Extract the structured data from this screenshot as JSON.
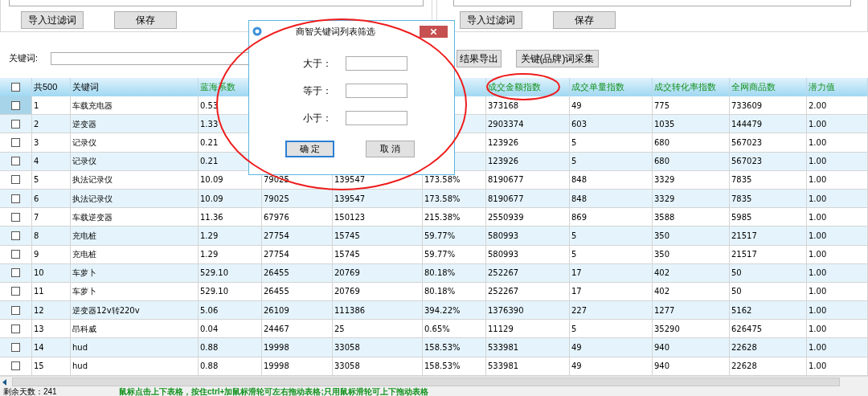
{
  "filter_panels": [
    {
      "buttons": [
        "导入过滤词",
        "保存"
      ]
    },
    {
      "buttons": [
        "导入过滤词",
        "保存"
      ]
    }
  ],
  "keyword_bar": {
    "label": "关键词:",
    "buttons": [
      "结果导出",
      "关键(品牌)词采集"
    ]
  },
  "table": {
    "header_checkbox": {
      "checked": false
    },
    "columns": [
      {
        "label": "共500",
        "kind": "basic"
      },
      {
        "label": "关键词",
        "kind": "basic"
      },
      {
        "label": "蓝海系数",
        "kind": "metric"
      },
      {
        "kind": "metric"
      },
      {
        "kind": "metric"
      },
      {
        "kind": "metric"
      },
      {
        "label": "成交金额指数",
        "kind": "metric"
      },
      {
        "label": "成交单量指数",
        "kind": "metric"
      },
      {
        "label": "成交转化率指数",
        "kind": "metric"
      },
      {
        "label": "全网商品数",
        "kind": "metric"
      },
      {
        "label": "潜力值",
        "kind": "metric"
      }
    ],
    "rows": [
      {
        "selected": true,
        "checked": false,
        "cells": [
          "1",
          "车载充电器",
          "0.53",
          null,
          null,
          null,
          "373168",
          "49",
          "775",
          "733609",
          "2.00"
        ]
      },
      {
        "selected": false,
        "checked": false,
        "cells": [
          "2",
          "逆变器",
          "1.33",
          null,
          null,
          null,
          "2903374",
          "603",
          "1035",
          "144479",
          "1.00"
        ]
      },
      {
        "selected": false,
        "checked": false,
        "cells": [
          "3",
          "记录仪",
          "0.21",
          null,
          null,
          null,
          "123926",
          "5",
          "680",
          "567023",
          "1.00"
        ]
      },
      {
        "selected": false,
        "checked": false,
        "cells": [
          "4",
          "记录仪",
          "0.21",
          null,
          null,
          null,
          "123926",
          "5",
          "680",
          "567023",
          "1.00"
        ]
      },
      {
        "selected": false,
        "checked": false,
        "cells": [
          "5",
          "执法记录仪",
          "10.09",
          "79025",
          "139547",
          "173.58%",
          "8190677",
          "848",
          "3329",
          "7835",
          "1.00"
        ]
      },
      {
        "selected": false,
        "checked": false,
        "cells": [
          "6",
          "执法记录仪",
          "10.09",
          "79025",
          "139547",
          "173.58%",
          "8190677",
          "848",
          "3329",
          "7835",
          "1.00"
        ]
      },
      {
        "selected": false,
        "checked": false,
        "cells": [
          "7",
          "车载逆变器",
          "11.36",
          "67976",
          "150123",
          "215.38%",
          "2550939",
          "869",
          "3588",
          "5985",
          "1.00"
        ]
      },
      {
        "selected": false,
        "checked": false,
        "cells": [
          "8",
          "充电桩",
          "1.29",
          "27754",
          "15745",
          "59.77%",
          "580993",
          "5",
          "350",
          "21517",
          "1.00"
        ]
      },
      {
        "selected": false,
        "checked": false,
        "cells": [
          "9",
          "充电桩",
          "1.29",
          "27754",
          "15745",
          "59.77%",
          "580993",
          "5",
          "350",
          "21517",
          "1.00"
        ]
      },
      {
        "selected": false,
        "checked": false,
        "cells": [
          "10",
          "车萝卜",
          "529.10",
          "26455",
          "20769",
          "80.18%",
          "252267",
          "17",
          "402",
          "50",
          "1.00"
        ]
      },
      {
        "selected": false,
        "checked": false,
        "cells": [
          "11",
          "车萝卜",
          "529.10",
          "26455",
          "20769",
          "80.18%",
          "252267",
          "17",
          "402",
          "50",
          "1.00"
        ]
      },
      {
        "selected": false,
        "checked": false,
        "cells": [
          "12",
          "逆变器12v转220v",
          "5.06",
          "26109",
          "111386",
          "394.22%",
          "1376390",
          "227",
          "1277",
          "5162",
          "1.00"
        ]
      },
      {
        "selected": false,
        "checked": false,
        "cells": [
          "13",
          "昂科威",
          "0.04",
          "24467",
          "25",
          "0.65%",
          "11129",
          "5",
          "35290",
          "626475",
          "1.00"
        ]
      },
      {
        "selected": false,
        "checked": false,
        "cells": [
          "14",
          "hud",
          "0.88",
          "19998",
          "33058",
          "158.53%",
          "533981",
          "49",
          "940",
          "22628",
          "1.00"
        ]
      },
      {
        "selected": false,
        "checked": false,
        "cells": [
          "15",
          "hud",
          "0.88",
          "19998",
          "33058",
          "158.53%",
          "533981",
          "49",
          "940",
          "22628",
          "1.00"
        ]
      }
    ]
  },
  "status_bar": {
    "days_left": "剩余天数：241",
    "hint": "鼠标点击上下表格，按住ctrl+加鼠标滑轮可左右拖动表格;只用鼠标滑轮可上下拖动表格"
  },
  "dialog": {
    "title": "商智关键词列表筛选",
    "fields": [
      {
        "label": "大于："
      },
      {
        "label": "等于："
      },
      {
        "label": "小于："
      }
    ],
    "buttons": [
      {
        "label": "确 定",
        "focused": true
      },
      {
        "label": "取 消",
        "focused": false
      }
    ]
  }
}
